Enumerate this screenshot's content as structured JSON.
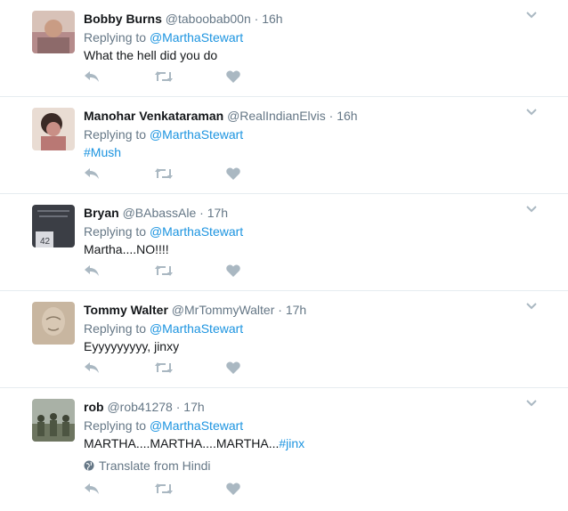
{
  "tweets": [
    {
      "name": "Bobby Burns",
      "handle": "@taboobab00n",
      "sep": "·",
      "time": "16h",
      "replying_prefix": "Replying to",
      "replying_to": "@MarthaStewart",
      "text": "What the hell did you do",
      "hashtag": "",
      "avatar_color": "#b58b8b"
    },
    {
      "name": "Manohar Venkataraman",
      "handle": "@RealIndianElvis",
      "sep": "·",
      "time": "16h",
      "replying_prefix": "Replying to",
      "replying_to": "@MarthaStewart",
      "text": "",
      "hashtag": "#Mush",
      "avatar_color": "#c98f86"
    },
    {
      "name": "Bryan",
      "handle": "@BAbassAle",
      "sep": "·",
      "time": "17h",
      "replying_prefix": "Replying to",
      "replying_to": "@MarthaStewart",
      "text": "Martha....NO!!!!",
      "hashtag": "",
      "avatar_color": "#3b3e45",
      "avatar_overlay": "42"
    },
    {
      "name": "Tommy Walter",
      "handle": "@MrTommyWalter",
      "sep": "·",
      "time": "17h",
      "replying_prefix": "Replying to",
      "replying_to": "@MarthaStewart",
      "text": "Eyyyyyyyyy, jinxy",
      "hashtag": "",
      "avatar_color": "#c8b6a0"
    },
    {
      "name": "rob",
      "handle": "@rob41278",
      "sep": "·",
      "time": "17h",
      "replying_prefix": "Replying to",
      "replying_to": "@MarthaStewart",
      "text": "MARTHA....MARTHA....MARTHA...",
      "hashtag": "#jinx",
      "translate": "Translate from Hindi",
      "avatar_color": "#6d7560"
    }
  ],
  "icons": {
    "reply": "reply-icon",
    "retweet": "retweet-icon",
    "like": "heart-icon",
    "caret": "chevron-down-icon",
    "globe": "globe-icon"
  },
  "colors": {
    "link": "#1c94e0",
    "muted": "#657786",
    "icon": "#aab8c2",
    "divider": "#e6ecf0"
  }
}
